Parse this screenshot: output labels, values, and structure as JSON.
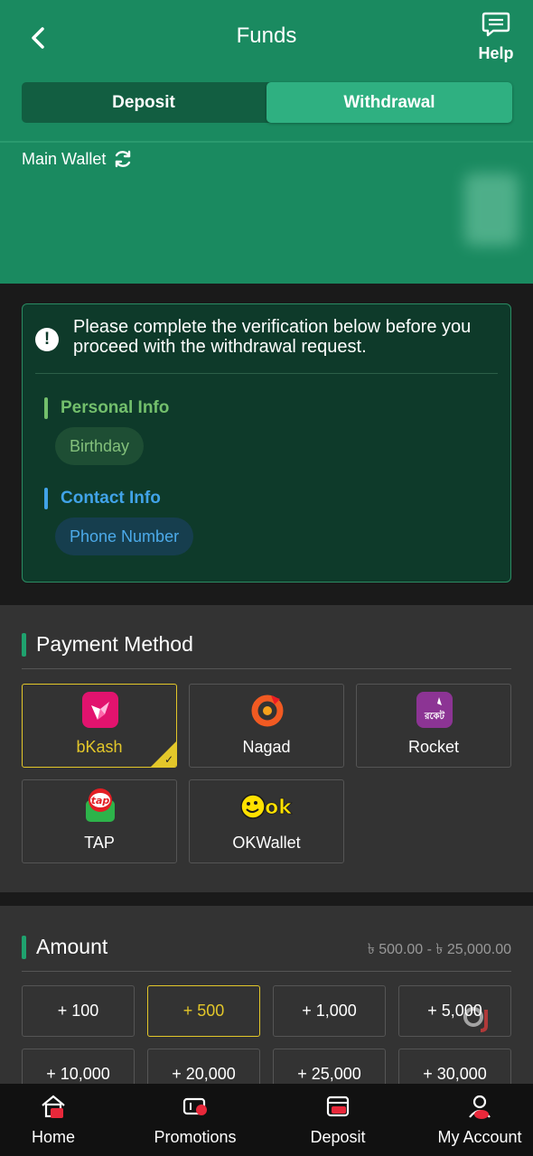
{
  "header": {
    "title": "Funds",
    "help_label": "Help",
    "tabs": [
      {
        "label": "Deposit",
        "active": false
      },
      {
        "label": "Withdrawal",
        "active": true
      }
    ],
    "wallet_label": "Main Wallet"
  },
  "verification": {
    "message": "Please complete the verification below before you proceed with the withdrawal request.",
    "sections": [
      {
        "title": "Personal Info",
        "item": "Birthday"
      },
      {
        "title": "Contact Info",
        "item": "Phone Number"
      }
    ]
  },
  "payment": {
    "title": "Payment Method",
    "methods": [
      {
        "label": "bKash",
        "selected": true,
        "icon": "bkash-logo"
      },
      {
        "label": "Nagad",
        "selected": false,
        "icon": "nagad-logo"
      },
      {
        "label": "Rocket",
        "selected": false,
        "icon": "rocket-logo"
      },
      {
        "label": "TAP",
        "selected": false,
        "icon": "tap-logo"
      },
      {
        "label": "OKWallet",
        "selected": false,
        "icon": "okwallet-logo"
      }
    ]
  },
  "amount": {
    "title": "Amount",
    "range": "৳ 500.00 - ৳ 25,000.00",
    "options": [
      {
        "label": "+ 100",
        "selected": false
      },
      {
        "label": "+ 500",
        "selected": true
      },
      {
        "label": "+ 1,000",
        "selected": false
      },
      {
        "label": "+ 5,000",
        "selected": false
      },
      {
        "label": "+ 10,000",
        "selected": false
      },
      {
        "label": "+ 20,000",
        "selected": false
      },
      {
        "label": "+ 25,000",
        "selected": false
      },
      {
        "label": "+ 30,000",
        "selected": false
      }
    ]
  },
  "nav": [
    {
      "label": "Home",
      "icon": "home-icon"
    },
    {
      "label": "Promotions",
      "icon": "ticket-icon"
    },
    {
      "label": "Deposit",
      "icon": "wallet-icon"
    },
    {
      "label": "My Account",
      "icon": "account-icon"
    }
  ],
  "colors": {
    "header_bg": "#1a8a60",
    "active_tab": "#2fb081",
    "selected_accent": "#e3c72a",
    "personal_info": "#73bf6c",
    "contact_info": "#41a3e8",
    "nav_icon_accent": "#e8283a"
  }
}
